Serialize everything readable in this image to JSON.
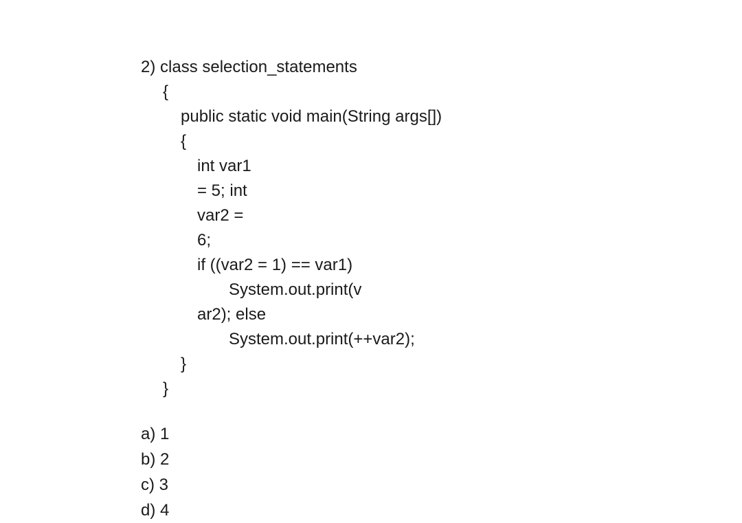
{
  "question": {
    "number": "2)",
    "code": {
      "line1": "class selection_statements",
      "line2": "{",
      "line3": "public static void main(String args[])",
      "line4": "{",
      "line5": "int var1",
      "line6": "= 5; int",
      "line7": "var2 =",
      "line8": "6;",
      "line9": "if ((var2 = 1) == var1)",
      "line10": "System.out.print(v",
      "line11": "ar2); else",
      "line12": "System.out.print(++var2);",
      "line13": "}",
      "line14": "}"
    },
    "options": {
      "a": "a) 1",
      "b": "b) 2",
      "c": "c) 3",
      "d": "d) 4"
    }
  }
}
